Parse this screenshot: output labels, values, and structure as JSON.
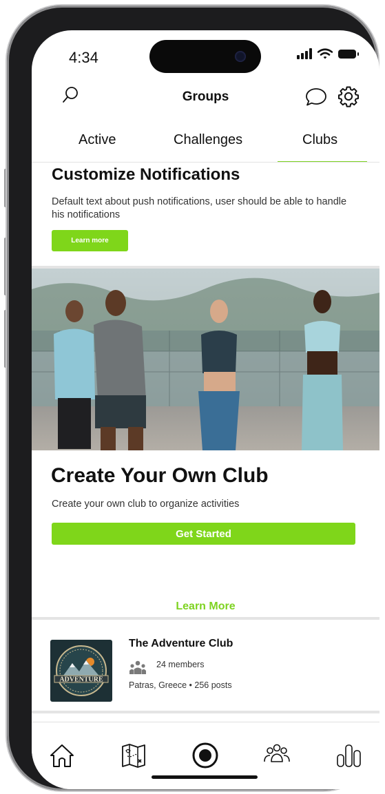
{
  "status_bar": {
    "time": "4:34"
  },
  "header": {
    "title": "Groups",
    "icons": [
      "search-icon",
      "chat-bubble-icon",
      "gear-icon"
    ]
  },
  "tabs": [
    {
      "label": "Active",
      "active": false
    },
    {
      "label": "Challenges",
      "active": false
    },
    {
      "label": "Clubs",
      "active": true
    }
  ],
  "notifications": {
    "title": "Customize Notifications",
    "text": "Default text about push notifications, user should be able to handle his notifications",
    "button_label": "Learn more"
  },
  "create_club": {
    "title": "Create Your Own Club",
    "description": "Create your own club to organize activities",
    "button_label": "Get Started",
    "link_label": "Learn More"
  },
  "club": {
    "name": "The Adventure Club",
    "members": "24 members",
    "meta": "Patras, Greece • 256 posts",
    "logo_text": "ADVENTURE"
  },
  "bottom_nav": {
    "items": [
      "home-icon",
      "map-icon",
      "record-icon",
      "groups-icon",
      "stats-icon"
    ]
  },
  "colors": {
    "accent": "#7fd61a",
    "text": "#111111"
  }
}
